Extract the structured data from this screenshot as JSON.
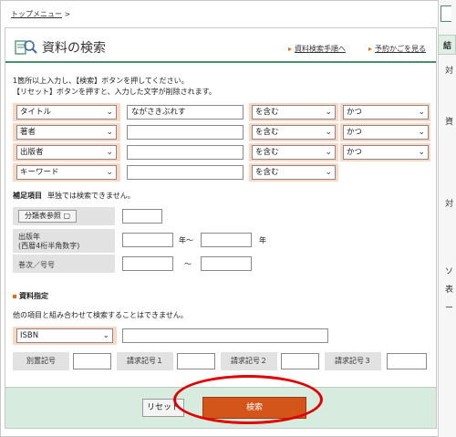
{
  "breadcrumb": {
    "top_label": "トップメニュー",
    "arrow": ">"
  },
  "header": {
    "title": "資料の検索",
    "links": [
      {
        "label": "資料検索手順へ"
      },
      {
        "label": "予約かごを見る"
      }
    ]
  },
  "intro": {
    "line1": "1箇所以上入力し、【検索】ボタンを押してください。",
    "line2": "【リセット】ボタンを押すと、入力した文字が削除されます。"
  },
  "criteria": [
    {
      "field": "タイトル",
      "value": "ながさきぶれす",
      "match": "を含む",
      "logic": "かつ"
    },
    {
      "field": "著者",
      "value": "",
      "match": "を含む",
      "logic": "かつ"
    },
    {
      "field": "出版者",
      "value": "",
      "match": "を含む",
      "logic": "かつ"
    },
    {
      "field": "キーワード",
      "value": "",
      "match": "を含む",
      "logic": ""
    }
  ],
  "supplement": {
    "heading": "補足項目",
    "note": "単独では検索できません。",
    "bunrui_button": "分類表参照",
    "year_label1": "出版年",
    "year_label2": "(西暦4桁半角数字)",
    "year_from_unit": "年～",
    "year_to_unit": "年",
    "volume_label": "巻次／号号",
    "tilde": "～"
  },
  "material": {
    "heading": "資料指定",
    "note": "他の項目と組み合わせて検索することはできません。",
    "type_select": "ISBN",
    "codes": [
      "別置記号",
      "請求記号１",
      "請求記号２",
      "請求記号３"
    ]
  },
  "actions": {
    "reset": "リセット",
    "search": "検索"
  },
  "right_panel": {
    "heading": "結",
    "chars": [
      "対",
      "資",
      "対",
      "ソ",
      "表",
      "ー"
    ]
  },
  "colors": {
    "accent_green": "#4a8f6b",
    "search_orange": "#d4551a",
    "criteria_bg": "#fcd7c6",
    "highlight_red": "#e00000"
  }
}
